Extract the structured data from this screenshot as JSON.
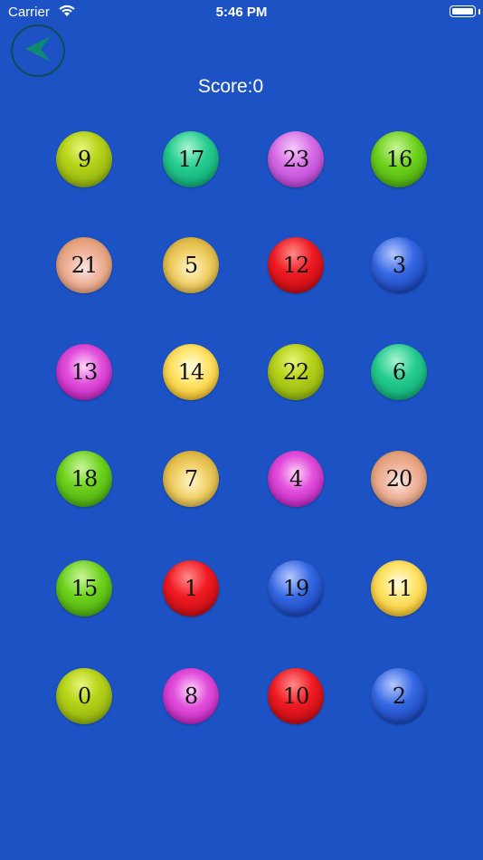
{
  "status_bar": {
    "carrier": "Carrier",
    "time": "5:46 PM"
  },
  "back_button": {
    "icon": "back-arrow-icon",
    "color": "#0f8a6e"
  },
  "score_label": "Score:0",
  "balls": [
    {
      "label": "9",
      "color": "olive"
    },
    {
      "label": "17",
      "color": "teal"
    },
    {
      "label": "23",
      "color": "purple"
    },
    {
      "label": "16",
      "color": "green"
    },
    {
      "label": "21",
      "color": "peach"
    },
    {
      "label": "5",
      "color": "gold"
    },
    {
      "label": "12",
      "color": "red"
    },
    {
      "label": "3",
      "color": "blue"
    },
    {
      "label": "13",
      "color": "magenta"
    },
    {
      "label": "14",
      "color": "yellow"
    },
    {
      "label": "22",
      "color": "olive"
    },
    {
      "label": "6",
      "color": "teal"
    },
    {
      "label": "18",
      "color": "green"
    },
    {
      "label": "7",
      "color": "gold"
    },
    {
      "label": "4",
      "color": "magenta"
    },
    {
      "label": "20",
      "color": "peach"
    },
    {
      "label": "15",
      "color": "green"
    },
    {
      "label": "1",
      "color": "red"
    },
    {
      "label": "19",
      "color": "blue"
    },
    {
      "label": "11",
      "color": "yellow"
    },
    {
      "label": "0",
      "color": "olive"
    },
    {
      "label": "8",
      "color": "magenta"
    },
    {
      "label": "10",
      "color": "red"
    },
    {
      "label": "2",
      "color": "blue"
    }
  ]
}
